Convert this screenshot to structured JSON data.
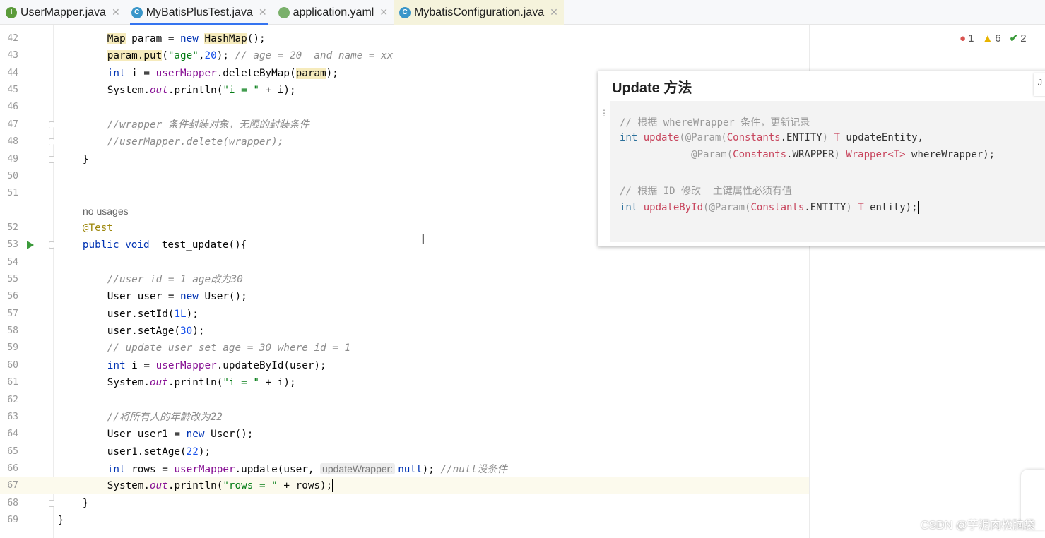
{
  "tabs": [
    {
      "label": "UserMapper.java",
      "icon": "interface-icon",
      "icon_letter": "I",
      "color": "#5b9b3a"
    },
    {
      "label": "MyBatisPlusTest.java",
      "icon": "class-icon",
      "icon_letter": "C",
      "color": "#3a96c9",
      "active": true
    },
    {
      "label": "application.yaml",
      "icon": "spring-yaml-icon",
      "icon_letter": "",
      "color": "#7ab06b"
    },
    {
      "label": "MybatisConfiguration.java",
      "icon": "class-icon",
      "icon_letter": "C",
      "color": "#3a96c9"
    }
  ],
  "status": {
    "errors": "1",
    "warnings": "6",
    "checks": "2"
  },
  "usages_hint": "no usages",
  "lines": [
    {
      "num": "42",
      "indent": 4,
      "tokens": [
        [
          "Map",
          "hl"
        ],
        [
          " param = ",
          ""
        ],
        [
          "new",
          "k"
        ],
        [
          " ",
          ""
        ],
        [
          "HashMap",
          "hl"
        ],
        [
          "();",
          ""
        ]
      ]
    },
    {
      "num": "43",
      "indent": 4,
      "tokens": [
        [
          "param.put",
          "hl"
        ],
        [
          "(",
          ""
        ],
        [
          "\"age\"",
          "s"
        ],
        [
          ",",
          ""
        ],
        [
          "20",
          "n"
        ],
        [
          "); ",
          ""
        ],
        [
          "// age = 20  and name = xx",
          "c"
        ]
      ]
    },
    {
      "num": "44",
      "indent": 4,
      "tokens": [
        [
          "int",
          "k"
        ],
        [
          " i = ",
          ""
        ],
        [
          "userMapper",
          "f"
        ],
        [
          ".deleteByMap(",
          ""
        ],
        [
          "param",
          "hl"
        ],
        [
          ");",
          ""
        ]
      ]
    },
    {
      "num": "45",
      "indent": 4,
      "tokens": [
        [
          "System.",
          ""
        ],
        [
          "out",
          "i"
        ],
        [
          ".println(",
          ""
        ],
        [
          "\"i = \"",
          "s"
        ],
        [
          " + i);",
          ""
        ]
      ]
    },
    {
      "num": "46",
      "indent": 4,
      "tokens": []
    },
    {
      "num": "47",
      "indent": 4,
      "fold": true,
      "tokens": [
        [
          "//wrapper 条件封装对象，无限的封装条件",
          "c"
        ]
      ]
    },
    {
      "num": "48",
      "indent": 4,
      "fold": true,
      "tokens": [
        [
          "//userMapper.delete(wrapper);",
          "c"
        ]
      ]
    },
    {
      "num": "49",
      "indent": 2,
      "fold": true,
      "tokens": [
        [
          "}",
          ""
        ]
      ]
    },
    {
      "num": "50",
      "indent": 0,
      "tokens": []
    },
    {
      "num": "51",
      "indent": 0,
      "tokens": []
    },
    {
      "num": "",
      "indent": 2,
      "usages": true,
      "tokens": []
    },
    {
      "num": "52",
      "indent": 2,
      "tokens": [
        [
          "@Test",
          "a"
        ]
      ]
    },
    {
      "num": "53",
      "indent": 2,
      "run": true,
      "fold": true,
      "tokens": [
        [
          "public void",
          ""
        ],
        [
          "  test_update(){",
          ""
        ]
      ]
    },
    {
      "num": "54",
      "indent": 4,
      "tokens": []
    },
    {
      "num": "55",
      "indent": 4,
      "tokens": [
        [
          "//user id = 1 age改为30",
          "c"
        ]
      ]
    },
    {
      "num": "56",
      "indent": 4,
      "tokens": [
        [
          "User user = ",
          ""
        ],
        [
          "new",
          "k"
        ],
        [
          " User();",
          ""
        ]
      ]
    },
    {
      "num": "57",
      "indent": 4,
      "tokens": [
        [
          "user.setId(",
          ""
        ],
        [
          "1L",
          "n"
        ],
        [
          ");",
          ""
        ]
      ]
    },
    {
      "num": "58",
      "indent": 4,
      "tokens": [
        [
          "user.setAge(",
          ""
        ],
        [
          "30",
          "n"
        ],
        [
          ");",
          ""
        ]
      ]
    },
    {
      "num": "59",
      "indent": 4,
      "tokens": [
        [
          "// update user set age = 30 where id = 1",
          "c"
        ]
      ]
    },
    {
      "num": "60",
      "indent": 4,
      "tokens": [
        [
          "int",
          "k"
        ],
        [
          " i = ",
          ""
        ],
        [
          "userMapper",
          "f"
        ],
        [
          ".updateById(user);",
          ""
        ]
      ]
    },
    {
      "num": "61",
      "indent": 4,
      "tokens": [
        [
          "System.",
          ""
        ],
        [
          "out",
          "i"
        ],
        [
          ".println(",
          ""
        ],
        [
          "\"i = \"",
          "s"
        ],
        [
          " + i);",
          ""
        ]
      ]
    },
    {
      "num": "62",
      "indent": 4,
      "tokens": []
    },
    {
      "num": "63",
      "indent": 4,
      "tokens": [
        [
          "//将所有人的年龄改为22",
          "c"
        ]
      ]
    },
    {
      "num": "64",
      "indent": 4,
      "tokens": [
        [
          "User user1 = ",
          ""
        ],
        [
          "new",
          "k"
        ],
        [
          " User();",
          ""
        ]
      ]
    },
    {
      "num": "65",
      "indent": 4,
      "tokens": [
        [
          "user1.setAge(",
          ""
        ],
        [
          "22",
          "n"
        ],
        [
          ");",
          ""
        ]
      ]
    },
    {
      "num": "66",
      "indent": 4,
      "tokens": [
        [
          "int",
          "k"
        ],
        [
          " rows = ",
          ""
        ],
        [
          "userMapper",
          "f"
        ],
        [
          ".update(user, ",
          ""
        ],
        [
          "updateWrapper:",
          "hint"
        ],
        [
          "null",
          "k"
        ],
        [
          "); ",
          ""
        ],
        [
          "//null没条件",
          "c"
        ]
      ]
    },
    {
      "num": "67",
      "indent": 4,
      "current": true,
      "tokens": [
        [
          "System.",
          ""
        ],
        [
          "out",
          "i"
        ],
        [
          ".println(",
          ""
        ],
        [
          "\"rows = \"",
          "s"
        ],
        [
          " + rows);",
          ""
        ]
      ]
    },
    {
      "num": "68",
      "indent": 2,
      "fold": true,
      "tokens": [
        [
          "}",
          ""
        ]
      ]
    },
    {
      "num": "69",
      "indent": 0,
      "tokens": [
        [
          "}",
          ""
        ]
      ]
    }
  ],
  "popup": {
    "title": "Update 方法",
    "side_tab": "J",
    "lines": [
      [
        [
          "// 根据 whereWrapper 条件，更新记录",
          "pc"
        ]
      ],
      [
        [
          "int",
          "pk"
        ],
        [
          " ",
          ""
        ],
        [
          "update",
          "pm"
        ],
        [
          "(@Param(",
          "pa"
        ],
        [
          "Constants",
          "pm"
        ],
        [
          ".ENTITY",
          ""
        ],
        [
          ") ",
          "pa"
        ],
        [
          "T",
          "pm"
        ],
        [
          " updateEntity,",
          ""
        ]
      ],
      [
        [
          "            @Param(",
          "pa"
        ],
        [
          "Constants",
          "pm"
        ],
        [
          ".WRAPPER",
          ""
        ],
        [
          ") ",
          "pa"
        ],
        [
          "Wrapper<T>",
          "pm"
        ],
        [
          " whereWrapper);",
          ""
        ]
      ],
      [],
      [
        [
          "// 根据 ID 修改  主键属性必须有值",
          "pc"
        ]
      ],
      [
        [
          "int",
          "pk"
        ],
        [
          " ",
          ""
        ],
        [
          "updateById",
          "pm"
        ],
        [
          "(@Param(",
          "pa"
        ],
        [
          "Constants",
          "pm"
        ],
        [
          ".ENTITY",
          ""
        ],
        [
          ") ",
          "pa"
        ],
        [
          "T",
          "pm"
        ],
        [
          " entity);",
          ""
        ]
      ]
    ]
  },
  "watermark": "CSDN @芋泥肉松脑袋"
}
